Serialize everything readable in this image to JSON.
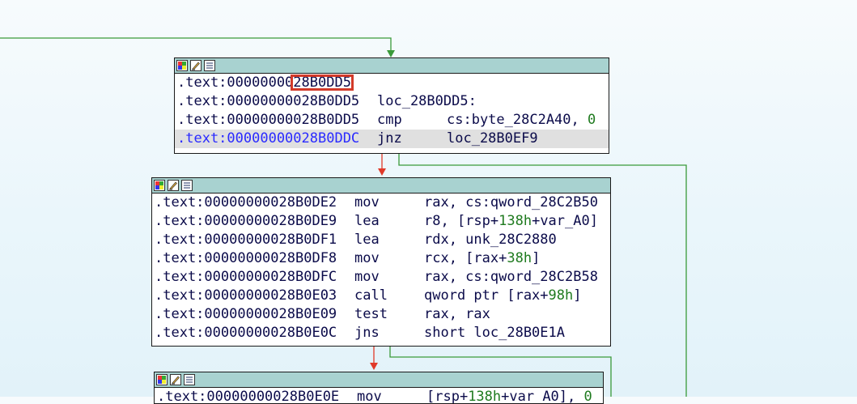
{
  "colors": {
    "edge_green": "#3a9a3a",
    "edge_red": "#e03a2a",
    "header_bg": "#a8d2d0",
    "highlight": "#d23a2a"
  },
  "icons": [
    "color-palette-icon",
    "rename-icon",
    "graph-view-icon"
  ],
  "nodes": [
    {
      "id": "node1",
      "lines": [
        {
          "addr": ".text:00000000",
          "addr_hl": "28B0DD5",
          "mnem": "",
          "ops": []
        },
        {
          "addr": ".text:00000000028B0DD5",
          "mnem": "loc_28B0DD5:",
          "ops": [],
          "is_label": true
        },
        {
          "addr": ".text:00000000028B0DD5",
          "mnem": "cmp",
          "ops": [
            {
              "t": "cs:byte_28C2A40, "
            },
            {
              "t": "0",
              "num": true
            }
          ]
        },
        {
          "addr": ".text:00000000028B0DDC",
          "mnem": "jnz",
          "ops": [
            {
              "t": "loc_28B0EF9"
            }
          ],
          "selected": true
        }
      ]
    },
    {
      "id": "node2",
      "lines": [
        {
          "addr": ".text:00000000028B0DE2",
          "mnem": "mov",
          "ops": [
            {
              "t": "rax, cs:qword_28C2B50"
            }
          ]
        },
        {
          "addr": ".text:00000000028B0DE9",
          "mnem": "lea",
          "ops": [
            {
              "t": "r8, [rsp+"
            },
            {
              "t": "138h",
              "num": true
            },
            {
              "t": "+var_A0]"
            }
          ]
        },
        {
          "addr": ".text:00000000028B0DF1",
          "mnem": "lea",
          "ops": [
            {
              "t": "rdx, unk_28C2880"
            }
          ]
        },
        {
          "addr": ".text:00000000028B0DF8",
          "mnem": "mov",
          "ops": [
            {
              "t": "rcx, [rax+"
            },
            {
              "t": "38h",
              "num": true
            },
            {
              "t": "]"
            }
          ]
        },
        {
          "addr": ".text:00000000028B0DFC",
          "mnem": "mov",
          "ops": [
            {
              "t": "rax, cs:qword_28C2B58"
            }
          ]
        },
        {
          "addr": ".text:00000000028B0E03",
          "mnem": "call",
          "ops": [
            {
              "t": "qword ptr [rax+"
            },
            {
              "t": "98h",
              "num": true
            },
            {
              "t": "]"
            }
          ]
        },
        {
          "addr": ".text:00000000028B0E09",
          "mnem": "test",
          "ops": [
            {
              "t": "rax, rax"
            }
          ]
        },
        {
          "addr": ".text:00000000028B0E0C",
          "mnem": "jns",
          "ops": [
            {
              "t": "short loc_28B0E1A"
            }
          ]
        }
      ]
    },
    {
      "id": "node3",
      "lines": [
        {
          "addr": ".text:00000000028B0E0E",
          "mnem": "mov",
          "ops": [
            {
              "t": "[rsp+"
            },
            {
              "t": "138h",
              "num": true
            },
            {
              "t": "+var_A0], "
            },
            {
              "t": "0",
              "num": true
            }
          ]
        }
      ]
    }
  ]
}
